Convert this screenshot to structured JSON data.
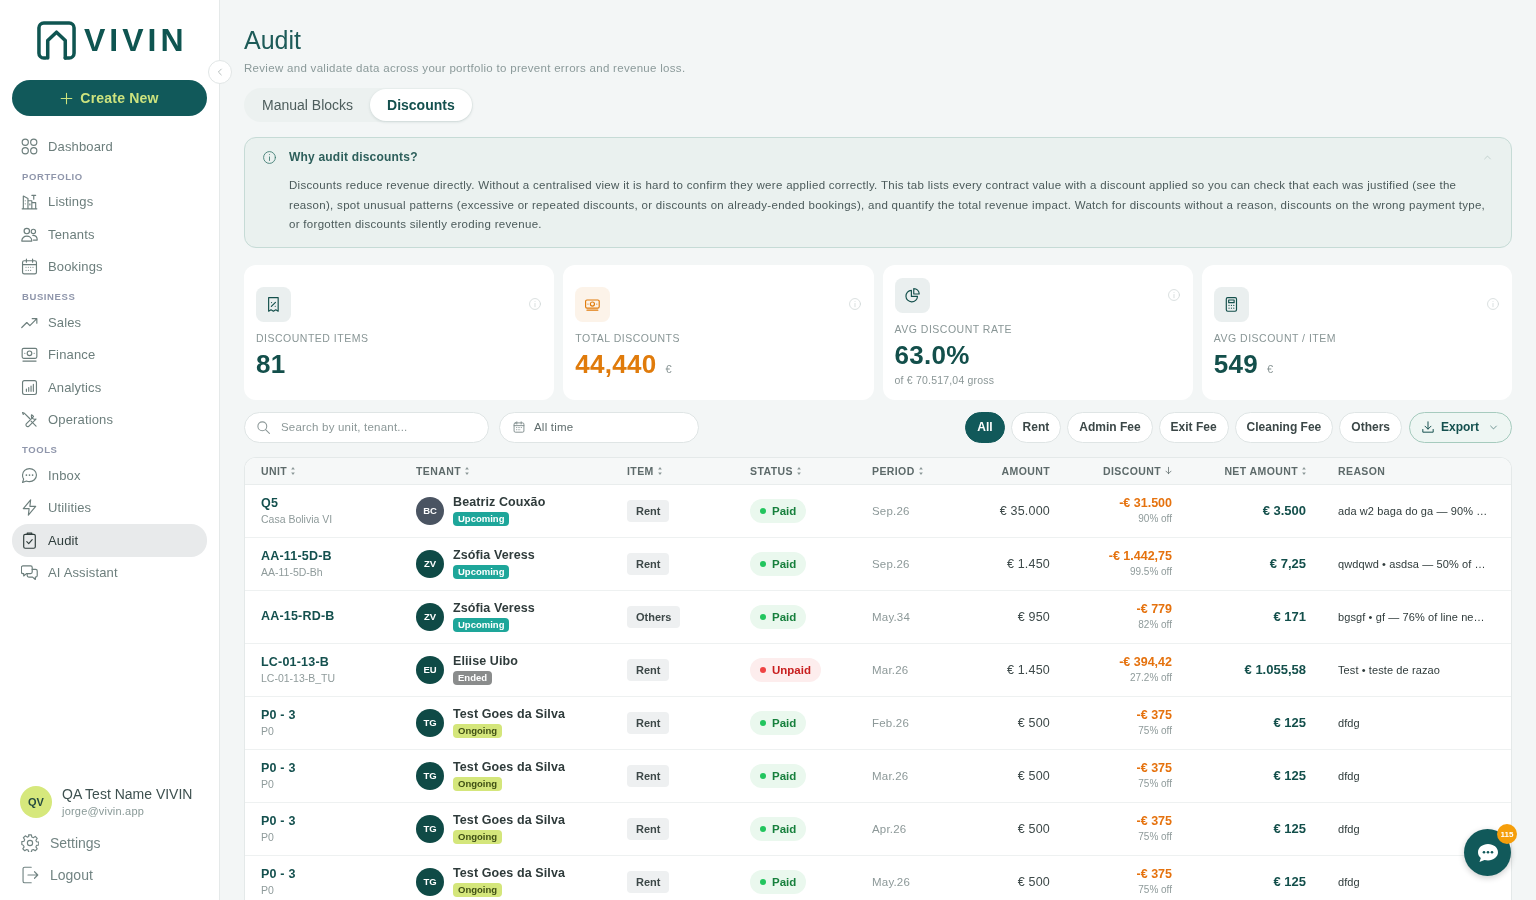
{
  "sidebar": {
    "logo": {
      "text": "VIVIN"
    },
    "create_button": {
      "label": "Create New"
    },
    "nav": [
      {
        "items": [
          {
            "label": "Dashboard",
            "selected": false
          }
        ]
      },
      {
        "heading": "PORTFOLIO",
        "items": [
          {
            "label": "Listings",
            "selected": false
          },
          {
            "label": "Tenants",
            "selected": false
          },
          {
            "label": "Bookings",
            "selected": false
          }
        ]
      },
      {
        "heading": "BUSINESS",
        "items": [
          {
            "label": "Sales",
            "selected": false
          },
          {
            "label": "Finance",
            "selected": false
          },
          {
            "label": "Analytics",
            "selected": false
          },
          {
            "label": "Operations",
            "selected": false
          }
        ]
      },
      {
        "heading": "TOOLS",
        "items": [
          {
            "label": "Inbox",
            "selected": false
          },
          {
            "label": "Utilities",
            "selected": false
          },
          {
            "label": "Audit",
            "selected": true
          },
          {
            "label": "AI Assistant",
            "selected": false
          }
        ]
      }
    ],
    "user": {
      "initials": "QV",
      "name": "QA Test Name VIVIN",
      "email": "jorge@vivin.app"
    },
    "footer_items": [
      {
        "label": "Settings"
      },
      {
        "label": "Logout"
      }
    ]
  },
  "page": {
    "title": "Audit",
    "subtitle": "Review and validate data across your portfolio to prevent errors and revenue loss."
  },
  "tabs": [
    {
      "label": "Manual Blocks",
      "selected": false
    },
    {
      "label": "Discounts",
      "selected": true
    }
  ],
  "info_panel": {
    "title": "Why audit discounts?",
    "expanded": true,
    "body": "Discounts reduce revenue directly. Without a centralised view it is hard to confirm they were applied correctly. This tab lists every contract value with a discount applied so you can check that each was justified (see the reason), spot unusual patterns (excessive or repeated discounts, or discounts on already-ended bookings), and quantify the total revenue impact. Watch for discounts without a reason, discounts on the wrong payment type, or forgotten discounts silently eroding revenue."
  },
  "stats": [
    {
      "kind": "count",
      "label": "DISCOUNTED ITEMS",
      "value": "81",
      "color": "#134f4b"
    },
    {
      "kind": "money",
      "label": "TOTAL DISCOUNTS",
      "value": "44,440",
      "unit": "€",
      "color": "#e07b0b"
    },
    {
      "kind": "rate",
      "label": "AVG DISCOUNT RATE",
      "value": "63.0%",
      "note": "of € 70.517,04 gross",
      "color": "#134f4b"
    },
    {
      "kind": "average",
      "label": "AVG DISCOUNT / ITEM",
      "value": "549",
      "unit": "€",
      "color": "#134f4b"
    }
  ],
  "filters": {
    "search": {
      "placeholder": "Search by unit, tenant..."
    },
    "date": {
      "value": "All time"
    },
    "chips": [
      {
        "label": "All",
        "selected": true
      },
      {
        "label": "Rent",
        "selected": false
      },
      {
        "label": "Admin Fee",
        "selected": false
      },
      {
        "label": "Exit Fee",
        "selected": false
      },
      {
        "label": "Cleaning Fee",
        "selected": false
      },
      {
        "label": "Others",
        "selected": false
      }
    ],
    "export": {
      "label": "Export"
    }
  },
  "table": {
    "columns": [
      {
        "label": "UNIT",
        "sortable": true,
        "sorted": false
      },
      {
        "label": "TENANT",
        "sortable": true,
        "sorted": false
      },
      {
        "label": "ITEM",
        "sortable": true,
        "sorted": false
      },
      {
        "label": "STATUS",
        "sortable": true,
        "sorted": false
      },
      {
        "label": "PERIOD",
        "sortable": true,
        "sorted": false
      },
      {
        "label": "AMOUNT",
        "sortable": false,
        "sorted": false
      },
      {
        "label": "DISCOUNT",
        "sortable": true,
        "sorted": true
      },
      {
        "label": "NET AMOUNT",
        "sortable": true,
        "sorted": false
      },
      {
        "label": "REASON",
        "sortable": false,
        "sorted": false
      }
    ],
    "rows": [
      {
        "unit": "Q5",
        "unit_detail": "Casa Bolivia VI",
        "tenant": {
          "initials": "BC",
          "name": "Beatriz Couxão",
          "color": "#4a5462",
          "badge": {
            "label": "Upcoming",
            "kind": "upcoming"
          }
        },
        "item": "Rent",
        "status": {
          "label": "Paid",
          "kind": "paid"
        },
        "period": "Sep.26",
        "amount": "€ 35.000",
        "discount": "-€ 31.500",
        "discount_share": "90% off",
        "net_amount": "€ 3.500",
        "reason": "ada w2 baga do ga — 90% …"
      },
      {
        "unit": "AA-11-5D-B",
        "unit_detail": "AA-11-5D-Bh",
        "tenant": {
          "initials": "ZV",
          "name": "Zsófia Veress",
          "color": "#0f4a46",
          "badge": {
            "label": "Upcoming",
            "kind": "upcoming"
          }
        },
        "item": "Rent",
        "status": {
          "label": "Paid",
          "kind": "paid"
        },
        "period": "Sep.26",
        "amount": "€ 1.450",
        "discount": "-€ 1.442,75",
        "discount_share": "99.5% off",
        "net_amount": "€ 7,25",
        "reason": "qwdqwd • asdsa — 50% of …"
      },
      {
        "unit": "AA-15-RD-B",
        "tenant": {
          "initials": "ZV",
          "name": "Zsófia Veress",
          "color": "#0f4a46",
          "badge": {
            "label": "Upcoming",
            "kind": "upcoming"
          }
        },
        "item": "Others",
        "status": {
          "label": "Paid",
          "kind": "paid"
        },
        "period": "May.34",
        "amount": "€ 950",
        "discount": "-€ 779",
        "discount_share": "82% off",
        "net_amount": "€ 171",
        "reason": "bgsgf • gf — 76% of line ne…"
      },
      {
        "unit": "LC-01-13-B",
        "unit_detail": "LC-01-13-B_TU",
        "tenant": {
          "initials": "EU",
          "name": "Eliise Uibo",
          "color": "#0f4a46",
          "badge": {
            "label": "Ended",
            "kind": "ended"
          }
        },
        "item": "Rent",
        "status": {
          "label": "Unpaid",
          "kind": "unpaid"
        },
        "period": "Mar.26",
        "amount": "€ 1.450",
        "discount": "-€ 394,42",
        "discount_share": "27.2% off",
        "net_amount": "€ 1.055,58",
        "reason": "Test • teste de razao"
      },
      {
        "unit": "P0 - 3",
        "unit_detail": "P0",
        "tenant": {
          "initials": "TG",
          "name": "Test Goes da Silva",
          "color": "#0f4a46",
          "badge": {
            "label": "Ongoing",
            "kind": "ongoing"
          }
        },
        "item": "Rent",
        "status": {
          "label": "Paid",
          "kind": "paid"
        },
        "period": "Feb.26",
        "amount": "€ 500",
        "discount": "-€ 375",
        "discount_share": "75% off",
        "net_amount": "€ 125",
        "reason": "dfdg"
      },
      {
        "unit": "P0 - 3",
        "unit_detail": "P0",
        "tenant": {
          "initials": "TG",
          "name": "Test Goes da Silva",
          "color": "#0f4a46",
          "badge": {
            "label": "Ongoing",
            "kind": "ongoing"
          }
        },
        "item": "Rent",
        "status": {
          "label": "Paid",
          "kind": "paid"
        },
        "period": "Mar.26",
        "amount": "€ 500",
        "discount": "-€ 375",
        "discount_share": "75% off",
        "net_amount": "€ 125",
        "reason": "dfdg"
      },
      {
        "unit": "P0 - 3",
        "unit_detail": "P0",
        "tenant": {
          "initials": "TG",
          "name": "Test Goes da Silva",
          "color": "#0f4a46",
          "badge": {
            "label": "Ongoing",
            "kind": "ongoing"
          }
        },
        "item": "Rent",
        "status": {
          "label": "Paid",
          "kind": "paid"
        },
        "period": "Apr.26",
        "amount": "€ 500",
        "discount": "-€ 375",
        "discount_share": "75% off",
        "net_amount": "€ 125",
        "reason": "dfdg"
      },
      {
        "unit": "P0 - 3",
        "unit_detail": "P0",
        "tenant": {
          "initials": "TG",
          "name": "Test Goes da Silva",
          "color": "#0f4a46",
          "badge": {
            "label": "Ongoing",
            "kind": "ongoing"
          }
        },
        "item": "Rent",
        "status": {
          "label": "Paid",
          "kind": "paid"
        },
        "period": "May.26",
        "amount": "€ 500",
        "discount": "-€ 375",
        "discount_share": "75% off",
        "net_amount": "€ 125",
        "reason": "dfdg"
      }
    ]
  },
  "chat": {
    "badge": "115"
  }
}
